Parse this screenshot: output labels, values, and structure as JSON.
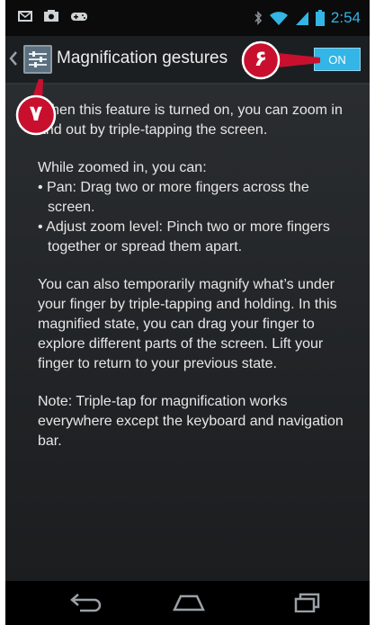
{
  "status_bar": {
    "time": "2:54",
    "left_icons": [
      "email-icon",
      "photo-icon",
      "gamepad-icon"
    ],
    "right_icons": [
      "bluetooth-icon",
      "wifi-icon",
      "signal-icon",
      "battery-icon"
    ]
  },
  "action_bar": {
    "title": "Magnification gestures",
    "toggle_label": "ON"
  },
  "callouts": {
    "toggle_callout": "۶",
    "icon_callout": "۷",
    "color": "#c8102e"
  },
  "content": {
    "p1": "When this feature is turned on, you can zoom in and out by triple-tapping the screen.",
    "p2_intro": "While zoomed in, you can:",
    "bullet1": "• Pan: Drag two or more fingers across the screen.",
    "bullet2": "• Adjust zoom level: Pinch two or more fingers together or spread them apart.",
    "p3": "You can also temporarily magnify what’s under your finger by triple-tapping and holding. In this magnified state, you can drag your finger to explore different parts of the screen. Lift your finger to return to your previous state.",
    "p4": "Note: Triple-tap for magnification works everywhere except the keyboard and navigation bar."
  },
  "nav_bar": {
    "icons": [
      "back-icon",
      "home-icon",
      "recent-apps-icon"
    ]
  },
  "colors": {
    "accent": "#33b5e5",
    "callout": "#c8102e",
    "background": "#1f2224"
  }
}
